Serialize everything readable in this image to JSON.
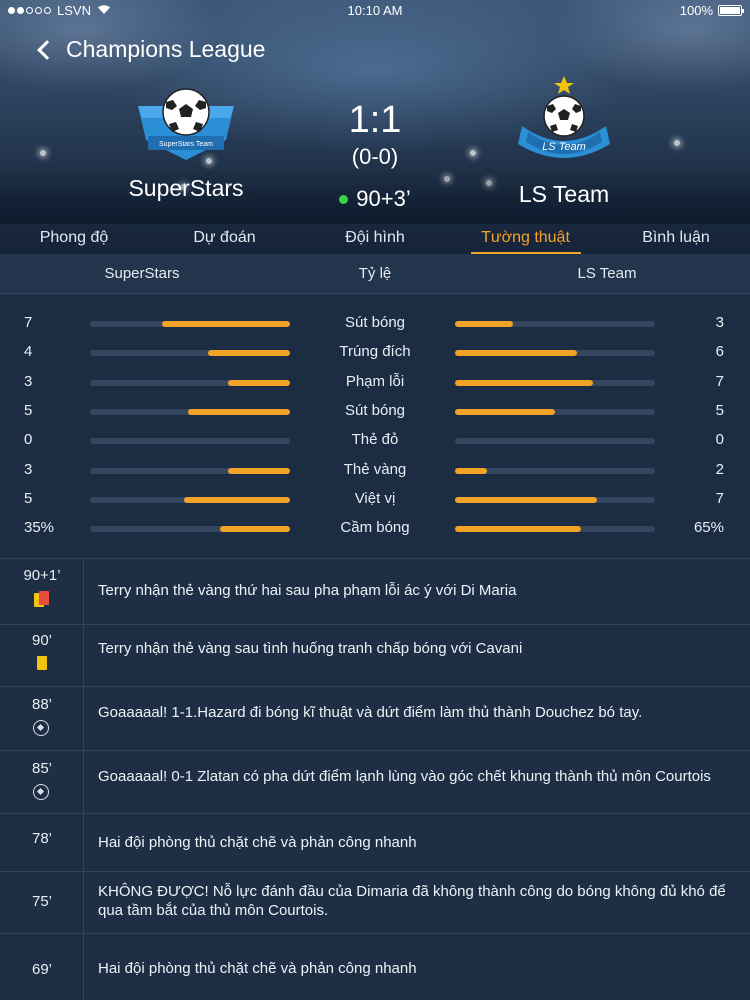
{
  "status_bar": {
    "carrier": "LSVN",
    "time": "10:10 AM",
    "battery": "100%"
  },
  "header": {
    "title": "Champions League",
    "home_team": "SuperStars",
    "away_team": "LS Team",
    "home_badge_text": "SuperStars Team",
    "away_badge_text": "LS Team",
    "score": "1:1",
    "half_time_score": "(0-0)",
    "minute": "90+3’"
  },
  "tabs": [
    {
      "label": "Phong độ",
      "active": false
    },
    {
      "label": "Dự đoán",
      "active": false
    },
    {
      "label": "Đội hình",
      "active": false
    },
    {
      "label": "Tường thuật",
      "active": true
    },
    {
      "label": "Bình luận",
      "active": false
    }
  ],
  "stats_header": {
    "home": "SuperStars",
    "middle": "Tỷ lệ",
    "away": "LS Team"
  },
  "stats": [
    {
      "label": "Sút bóng",
      "home": "7",
      "away": "3",
      "home_fill": 0.64,
      "away_fill": 0.29
    },
    {
      "label": "Trúng đích",
      "home": "4",
      "away": "6",
      "home_fill": 0.41,
      "away_fill": 0.61
    },
    {
      "label": "Phạm lỗi",
      "home": "3",
      "away": "7",
      "home_fill": 0.31,
      "away_fill": 0.69
    },
    {
      "label": "Sút bóng",
      "home": "5",
      "away": "5",
      "home_fill": 0.51,
      "away_fill": 0.5
    },
    {
      "label": "Thẻ đỏ",
      "home": "0",
      "away": "0",
      "home_fill": 0,
      "away_fill": 0
    },
    {
      "label": "Thẻ vàng",
      "home": "3",
      "away": "2",
      "home_fill": 0.31,
      "away_fill": 0.16
    },
    {
      "label": "Việt vị",
      "home": "5",
      "away": "7",
      "home_fill": 0.53,
      "away_fill": 0.71
    },
    {
      "label": "Cầm bóng",
      "home": "35%",
      "away": "65%",
      "home_fill": 0.35,
      "away_fill": 0.63
    }
  ],
  "commentary": [
    {
      "time": "90+1’",
      "icon": "second-yellow-card-icon",
      "text": "Terry nhận thẻ vàng thứ hai sau pha phạm lỗi ác ý với Di Maria"
    },
    {
      "time": "90’",
      "icon": "yellow-card-icon",
      "text": "Terry nhận thẻ vàng sau tình huống tranh chấp bóng với Cavani"
    },
    {
      "time": "88’",
      "icon": "football-icon",
      "text": "Goaaaaal! 1-1.Hazard đi bóng kĩ thuật và dứt điểm làm thủ thành Douchez bó tay."
    },
    {
      "time": "85’",
      "icon": "football-icon",
      "text": "Goaaaaal! 0-1 Zlatan có pha dứt điểm lạnh lùng vào góc chết khung thành thủ môn Courtois"
    },
    {
      "time": "78’",
      "icon": "",
      "text": "Hai đội phòng thủ chặt chẽ và phản công nhanh"
    },
    {
      "time": "75’",
      "icon": "",
      "text": "KHÔNG ĐƯỢC! Nỗ lực đánh đầu của Dimaria đã không thành công do bóng không đủ khó để qua tầm bắt của thủ môn Courtois."
    },
    {
      "time": "69’",
      "icon": "",
      "text": "Hai đội phòng thủ chặt chẽ và phản công nhanh"
    }
  ],
  "colors": {
    "accent": "#f0a326",
    "live": "#3cd34a",
    "background": "#1e2f45"
  }
}
